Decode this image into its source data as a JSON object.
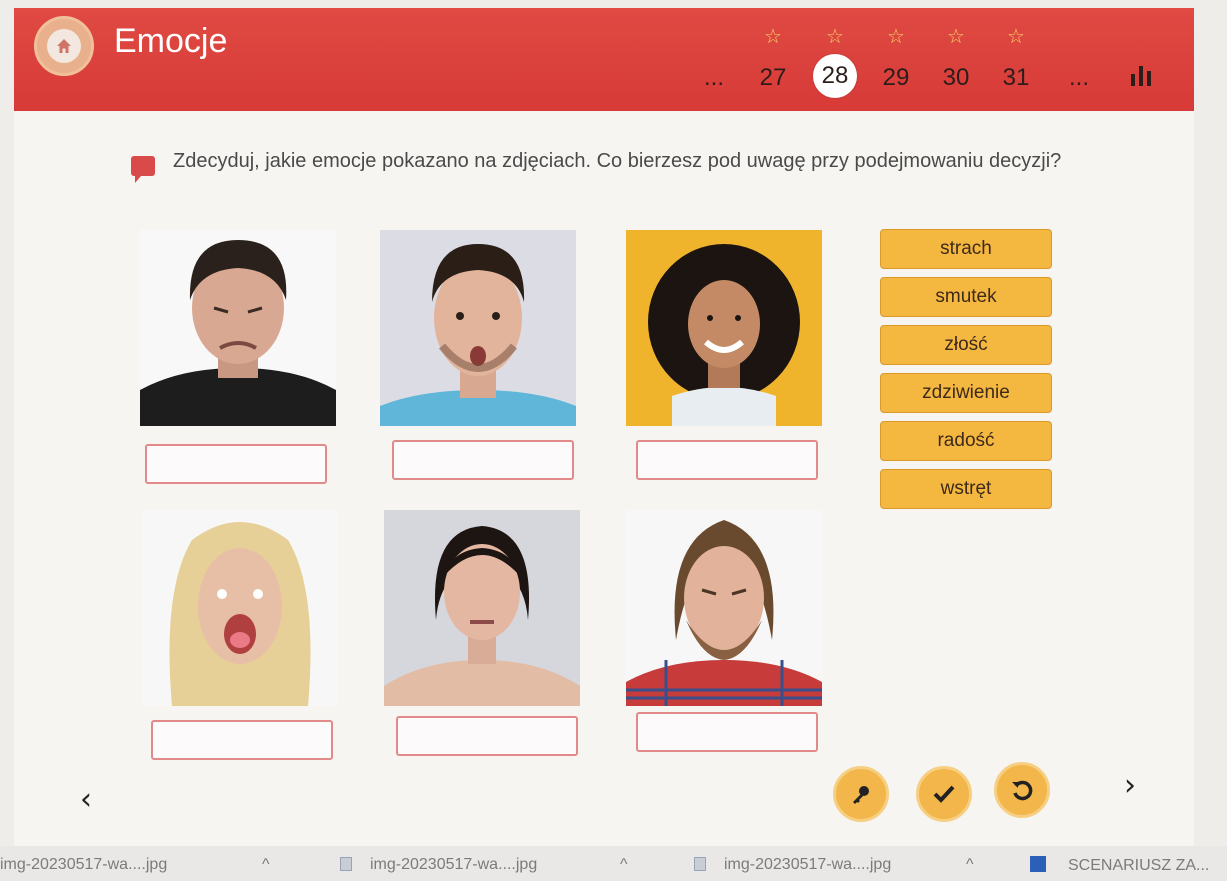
{
  "header": {
    "title": "Emocje",
    "pages": [
      "...",
      "27",
      "28",
      "29",
      "30",
      "31",
      "..."
    ],
    "current_page": "28",
    "star_glyph": "☆"
  },
  "instruction": {
    "text": "Zdecyduj, jakie emocje pokazano na zdjęciach. Co bierzesz pod uwagę przy podejmowaniu decyzji?"
  },
  "emotions": [
    "strach",
    "smutek",
    "złość",
    "zdziwienie",
    "radość",
    "wstręt"
  ],
  "nav": {
    "prev": "‹",
    "next": "›"
  },
  "taskbar": {
    "items": [
      "img-20230517-wa....jpg",
      "img-20230517-wa....jpg",
      "img-20230517-wa....jpg",
      "SCENARIUSZ ZA..."
    ],
    "caret": "^"
  },
  "colors": {
    "header": "#d73a37",
    "chip": "#f4b740",
    "answer_border": "#e28a8a",
    "control_button": "#f2b64b"
  }
}
